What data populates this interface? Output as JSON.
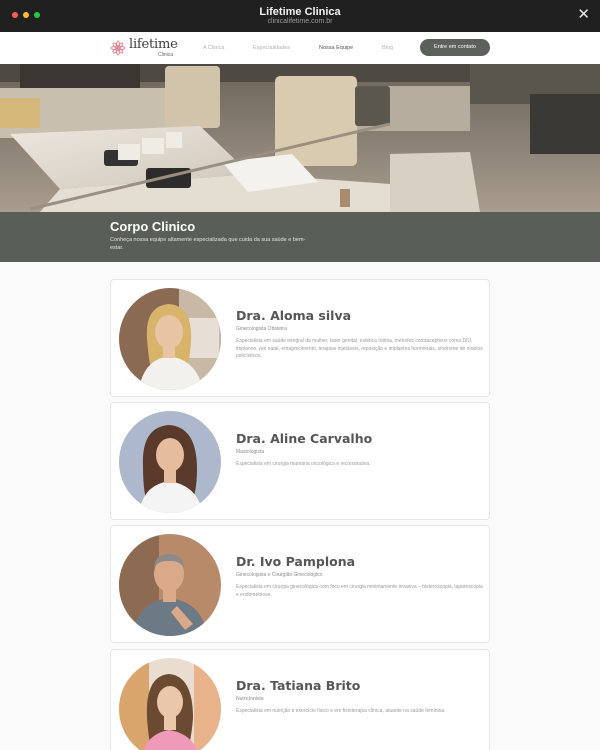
{
  "window": {
    "title": "Lifetime Clinica",
    "url": "clinicalifetime.com.br",
    "close_icon": "close-icon"
  },
  "nav": {
    "logo_text": "lifetime",
    "logo_sub": "Clinica",
    "links": [
      {
        "label": "A Clinica",
        "active": false
      },
      {
        "label": "Especialidades",
        "active": false
      },
      {
        "label": "Nossa Equipe",
        "active": true
      },
      {
        "label": "Blog",
        "active": false
      }
    ],
    "cta_label": "Entre em contato"
  },
  "hero": {
    "title": "Corpo Clinico",
    "subtitle": "Conheça nossa equipe altamente especializada que cuida da sua saúde e bem-estar."
  },
  "doctors": [
    {
      "name": "Dra. Aloma silva",
      "role": "Ginecologista Obstetra",
      "description": "Especialista em saúde integral da mulher, laser genital, estética íntima, métodos contraceptivos como DIU, implanon, pré natal, emagrecimento, terapias injetáveis, reposição e implantes hormonais, síndrome de ovários policísticos."
    },
    {
      "name": "Dra. Aline Carvalho",
      "role": "Mastologista",
      "description": "Especialista em cirurgia mamária oncológica e reconstrutiva."
    },
    {
      "name": "Dr. Ivo Pamplona",
      "role": "Ginecologista e Cirurgião Ginecológico",
      "description": "Especialista em cirurgia ginecológica com foco em cirurgia minimamente invasiva – histeroscopia, laparoscopia e endometriose."
    },
    {
      "name": "Dra. Tatiana Brito",
      "role": "Nutricionista",
      "description": "Especialista em nutrição e exercício físico e em fisioterapia clínica, atuante na saúde feminina."
    }
  ],
  "colors": {
    "titlebar": "#202020",
    "accent": "#5c615c",
    "band": "#595f58",
    "logo_pink": "#e08a96"
  }
}
